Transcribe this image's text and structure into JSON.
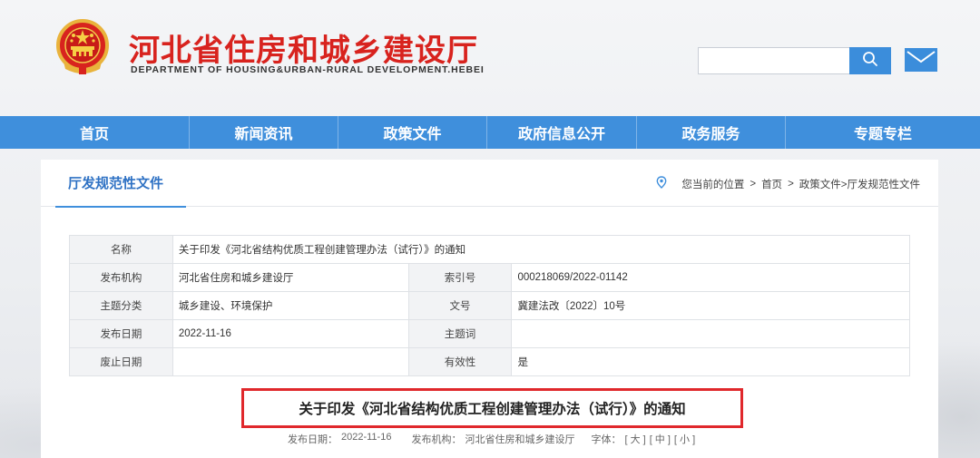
{
  "header": {
    "title": "河北省住房和城乡建设厅",
    "subtitle": "DEPARTMENT OF HOUSING&URBAN-RURAL DEVELOPMENT.HEBEI",
    "search_placeholder": "",
    "icons": {
      "emblem": "national-emblem-icon",
      "search": "search-icon",
      "mail": "mail-icon"
    }
  },
  "nav": {
    "items": [
      {
        "label": "首页"
      },
      {
        "label": "新闻资讯"
      },
      {
        "label": "政策文件"
      },
      {
        "label": "政府信息公开"
      },
      {
        "label": "政务服务"
      },
      {
        "label": "专题专栏"
      }
    ]
  },
  "panel": {
    "title": "厅发规范性文件",
    "breadcrumb": {
      "prefix": "您当前的位置",
      "sep": ">",
      "home": "首页",
      "path": "政策文件>厅发规范性文件"
    }
  },
  "info": {
    "name_label": "名称",
    "name_value": "关于印发《河北省结构优质工程创建管理办法（试行）》的通知",
    "rows": [
      {
        "l1": "发布机构",
        "v1": "河北省住房和城乡建设厅",
        "l2": "索引号",
        "v2": "000218069/2022-01142"
      },
      {
        "l1": "主题分类",
        "v1": "城乡建设、环境保护",
        "l2": "文号",
        "v2": "冀建法改〔2022〕10号"
      },
      {
        "l1": "发布日期",
        "v1": "2022-11-16",
        "l2": "主题词",
        "v2": ""
      },
      {
        "l1": "废止日期",
        "v1": "",
        "l2": "有效性",
        "v2": "是"
      }
    ]
  },
  "document": {
    "title": "关于印发《河北省结构优质工程创建管理办法（试行）》的通知",
    "meta": {
      "date_label": "发布日期：",
      "date": "2022-11-16",
      "org_label": "发布机构：",
      "org": "河北省住房和城乡建设厅",
      "font_label": "字体：",
      "font_large": "[ 大 ]",
      "font_medium": "[ 中 ]",
      "font_small": "[ 小 ]"
    }
  },
  "colors": {
    "brand_red": "#d8231e",
    "nav_blue": "#3f8fdc",
    "highlight_red": "#e0282c"
  }
}
